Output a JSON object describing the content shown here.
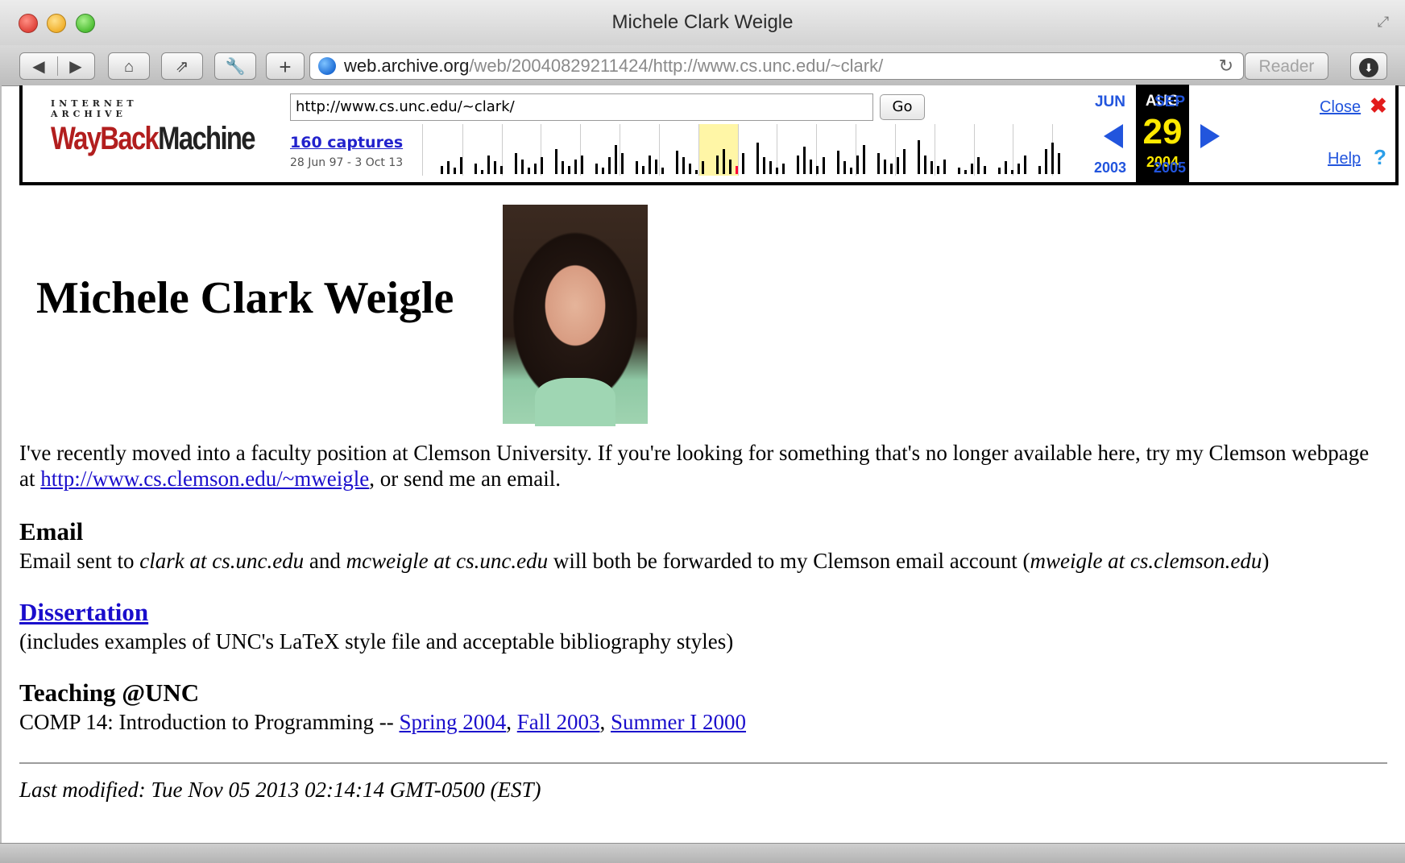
{
  "window": {
    "title": "Michele Clark Weigle"
  },
  "toolbar": {
    "back_icon": "◀",
    "forward_icon": "▶",
    "home_icon": "⌂",
    "share_icon": "⇗",
    "wrench_icon": "🔧",
    "new_tab_icon": "+",
    "url_host": "web.archive.org",
    "url_path": "/web/20040829211424/http://www.cs.unc.edu/~clark/",
    "reload_icon": "↻",
    "reader_label": "Reader",
    "download_icon": "⬇"
  },
  "wayback": {
    "logo_top": "INTERNET ARCHIVE",
    "logo_main_a": "WayBack",
    "logo_main_b": "Machine",
    "url_value": "http://www.cs.unc.edu/~clark/",
    "go_label": "Go",
    "captures_label": "160 captures",
    "range_label": "28 Jun 97 - 3 Oct 13",
    "prev_month": "JUN",
    "cur_month": "AUG",
    "next_month": "SEP",
    "cur_day": "29",
    "prev_year": "2003",
    "cur_year": "2004",
    "next_year": "2005",
    "close_label": "Close",
    "close_icon": "✖",
    "help_label": "Help",
    "help_icon": "?"
  },
  "page": {
    "heading": "Michele Clark Weigle",
    "intro_text": "I've recently moved into a faculty position at Clemson University. If you're looking for something that's no longer available here, try my Clemson webpage at ",
    "intro_link": "http://www.cs.clemson.edu/~mweigle",
    "intro_tail": ", or send me an email.",
    "email_heading": "Email",
    "email_pre": "Email sent to ",
    "email_addr1": "clark at cs.unc.edu",
    "email_mid": " and ",
    "email_addr2": "mcweigle at cs.unc.edu",
    "email_post": " will both be forwarded to my Clemson email account (",
    "email_addr3": "mweigle at cs.clemson.edu",
    "email_end": ")",
    "dissertation_link": "Dissertation",
    "dissertation_note": "(includes examples of UNC's LaTeX style file and acceptable bibliography styles)",
    "teaching_heading": "Teaching @UNC",
    "teaching_pre": "COMP 14: Introduction to Programming -- ",
    "teaching_links": [
      "Spring 2004",
      "Fall 2003",
      "Summer I 2000"
    ],
    "teaching_sep": ", ",
    "last_modified": "Last modified: Tue Nov 05 2013 02:14:14 GMT-0500 (EST)"
  }
}
